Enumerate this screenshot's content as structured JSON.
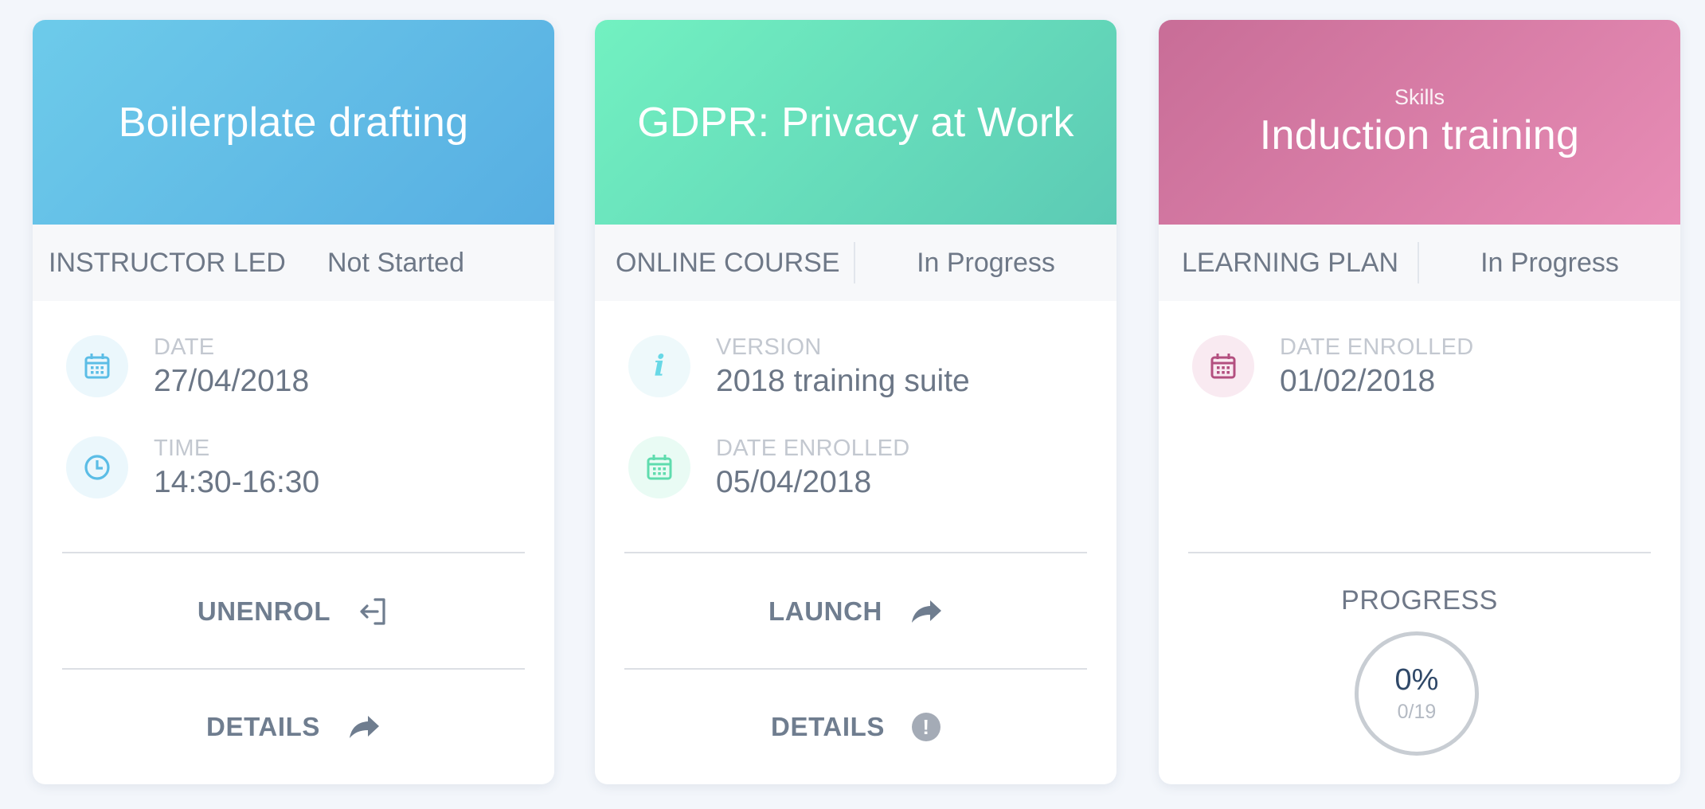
{
  "cards": [
    {
      "title": "Boilerplate drafting",
      "type": "INSTRUCTOR LED",
      "status": "Not Started",
      "rows": [
        {
          "label": "DATE",
          "value": "27/04/2018",
          "icon": "calendar-icon"
        },
        {
          "label": "TIME",
          "value": "14:30-16:30",
          "icon": "clock-icon"
        }
      ],
      "actions": [
        {
          "label": "UNENROL",
          "icon": "unenrol-icon"
        },
        {
          "label": "DETAILS",
          "icon": "arrow-forward-icon"
        }
      ],
      "accent": "#5bbde6"
    },
    {
      "title": "GDPR: Privacy at Work",
      "type": "ONLINE COURSE",
      "status": "In Progress",
      "rows": [
        {
          "label": "VERSION",
          "value": "2018 training suite",
          "icon": "info-icon",
          "icon_glyph": "i"
        },
        {
          "label": "DATE ENROLLED",
          "value": "05/04/2018",
          "icon": "calendar-icon"
        }
      ],
      "actions": [
        {
          "label": "LAUNCH",
          "icon": "arrow-forward-icon"
        },
        {
          "label": "DETAILS",
          "icon": "exclamation-icon",
          "icon_glyph": "!"
        }
      ],
      "accent": "#5fdcae"
    },
    {
      "category": "Skills",
      "title": "Induction training",
      "type": "LEARNING PLAN",
      "status": "In Progress",
      "rows": [
        {
          "label": "DATE ENROLLED",
          "value": "01/02/2018",
          "icon": "calendar-icon"
        }
      ],
      "progress": {
        "label": "PROGRESS",
        "percent": "0%",
        "count": "0/19",
        "value": 0
      },
      "accent": "#b34f7f"
    }
  ]
}
